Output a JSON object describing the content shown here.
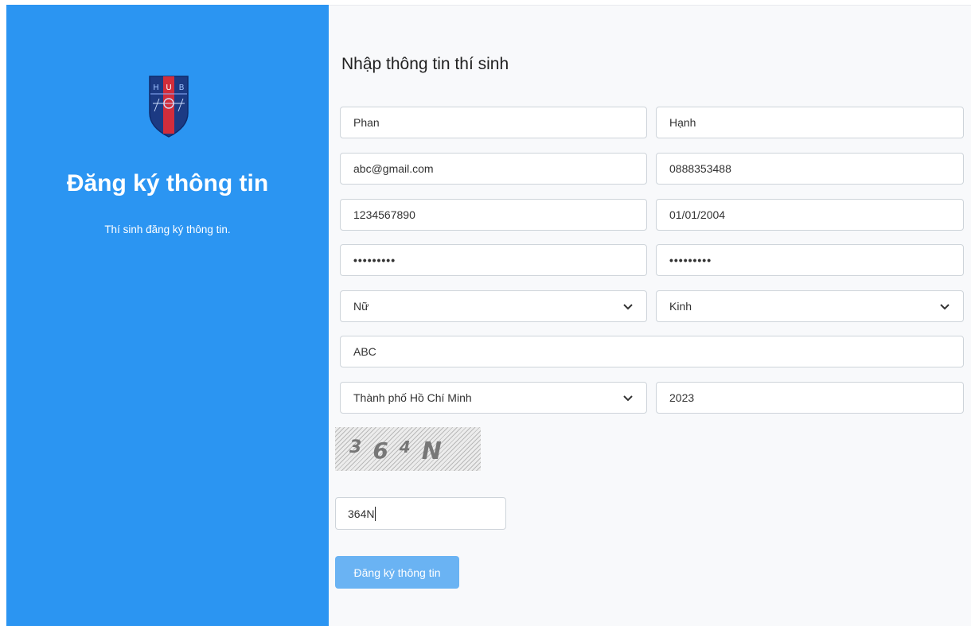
{
  "left": {
    "title": "Đăng ký thông tin",
    "subtitle": "Thí sinh đăng ký thông tin.",
    "logo_letters": [
      "H",
      "U",
      "B"
    ]
  },
  "form": {
    "title": "Nhập thông tin thí sinh",
    "last_name": "Phan",
    "first_name": "Hạnh",
    "email": "abc@gmail.com",
    "phone": "0888353488",
    "id_number": "1234567890",
    "birth_date": "01/01/2004",
    "password_mask": "•••••••••",
    "confirm_password_mask": "•••••••••",
    "gender": "Nữ",
    "ethnicity": "Kinh",
    "address": "ABC",
    "province": "Thành phố Hồ Chí Minh",
    "graduation_year": "2023",
    "captcha_chars": [
      "3",
      "6",
      "4",
      "N"
    ],
    "captcha_value": "364N",
    "submit_label": "Đăng ký thông tin"
  },
  "colors": {
    "primary": "#2b95f2",
    "button": "#6ab3f3",
    "form_background": "#f8f9fb"
  },
  "icons": {
    "select": "chevron-down-icon",
    "logo": "hub-shield-logo"
  }
}
